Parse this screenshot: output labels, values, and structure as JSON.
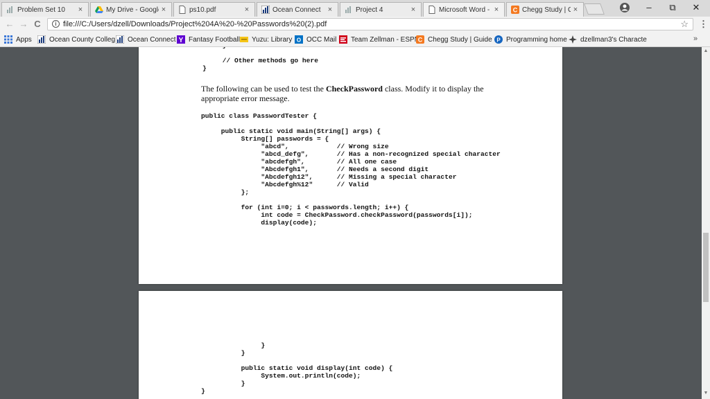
{
  "tabs": [
    {
      "title": "Problem Set 10",
      "icon": "ocean-connect-icon",
      "close": "×"
    },
    {
      "title": "My Drive - Google",
      "icon": "google-drive-icon",
      "close": "×"
    },
    {
      "title": "ps10.pdf",
      "icon": "document-icon",
      "close": "×"
    },
    {
      "title": "Ocean Connect",
      "icon": "ocean-connect-icon",
      "close": "×"
    },
    {
      "title": "Project 4",
      "icon": "ocean-connect-icon",
      "close": "×"
    },
    {
      "title": "Microsoft Word -",
      "icon": "document-icon",
      "close": "×"
    },
    {
      "title": "Chegg Study | Gui",
      "icon": "chegg-icon",
      "close": "×"
    }
  ],
  "window_controls": {
    "minimize": "–",
    "restore": "⧉",
    "close": "✕"
  },
  "toolbar": {
    "back": "←",
    "forward": "→",
    "reload": "C",
    "url": "file:///C:/Users/dzell/Downloads/Project%204A%20-%20Passwords%20(2).pdf",
    "info": "i",
    "star": "☆",
    "menu": "⋮"
  },
  "bookmarks": [
    {
      "label": "Apps",
      "icon": "apps-grid-icon"
    },
    {
      "label": "Ocean County Colleg",
      "icon": "ocean-connect-icon"
    },
    {
      "label": "Ocean Connect",
      "icon": "ocean-connect-icon"
    },
    {
      "label": "Fantasy Football",
      "icon": "yahoo-icon"
    },
    {
      "label": "Yuzu: Library",
      "icon": "yuzu-icon"
    },
    {
      "label": "OCC Mail",
      "icon": "outlook-icon"
    },
    {
      "label": "Team Zellman - ESPN",
      "icon": "espn-icon"
    },
    {
      "label": "Chegg Study | Guide",
      "icon": "chegg-icon"
    },
    {
      "label": "Programming home",
      "icon": "programming-icon"
    },
    {
      "label": "dzellman3's Characte",
      "icon": "character-icon"
    }
  ],
  "bookmarks_more": "»",
  "document": {
    "page1": {
      "code_top": "     }\n\n     // Other methods go here\n}",
      "prose_before": "The following can be used to test the ",
      "prose_bold": "CheckPassword",
      "prose_after": " class. Modify it to display the appropriate error message.",
      "code_tester": "public class PasswordTester {\n\n     public static void main(String[] args) {\n          String[] passwords = {\n               \"abcd\",            // Wrong size\n               \"abcd_defg\",       // Has a non-recognized special character\n               \"abcdefgh\",        // All one case\n               \"Abcdefgh1\",       // Needs a second digit\n               \"Abcdefgh12\",      // Missing a special character\n               \"Abcdefgh%12\"      // Valid\n          };\n\n          for (int i=0; i < passwords.length; i++) {\n               int code = CheckPassword.checkPassword(passwords[i]);\n               display(code);"
    },
    "page2": {
      "code": "               }\n          }\n\n          public static void display(int code) {\n               System.out.println(code);\n          }\n}"
    }
  },
  "colors": {
    "viewer_bg": "#525659",
    "chrome_bg": "#f2f2f2",
    "chegg_orange": "#f47920",
    "espn_red": "#d0021b"
  }
}
